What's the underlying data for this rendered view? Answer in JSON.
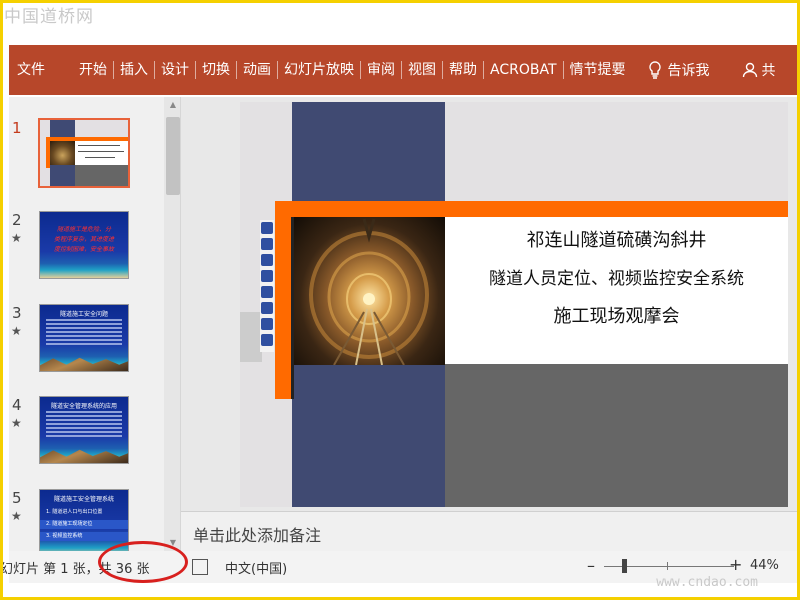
{
  "watermark": {
    "top": "中国道桥网",
    "bottom": "www.cndao.com"
  },
  "ribbon": {
    "tabs": [
      "文件",
      "开始",
      "插入",
      "设计",
      "切换",
      "动画",
      "幻灯片放映",
      "审阅",
      "视图",
      "帮助",
      "ACROBAT",
      "情节提要"
    ],
    "tell_me": "告诉我",
    "share": "共"
  },
  "thumbnails": [
    {
      "num": "1",
      "star": "",
      "active": true
    },
    {
      "num": "2",
      "star": "★",
      "text": [
        "隧道施工是危险、分",
        "类程序复杂，其进度进",
        "度控制困难，安全事故"
      ]
    },
    {
      "num": "3",
      "star": "★",
      "title": "隧道施工安全问题"
    },
    {
      "num": "4",
      "star": "★",
      "title": "隧道安全管理系统的应用"
    },
    {
      "num": "5",
      "star": "★",
      "title": "隧道施工安全管理系统",
      "items": [
        "1. 隧道进人口与出口位置",
        "2. 隧道施工现场定位",
        "3. 视频监控系统"
      ]
    }
  ],
  "slide": {
    "line1": "祁连山隧道硫磺沟斜井",
    "line2": "隧道人员定位、视频监控安全系统",
    "line3": "施工现场观摩会"
  },
  "notes": {
    "placeholder": "单击此处添加备注"
  },
  "status": {
    "slide_info": "幻灯片 第 1 张，共 36 张",
    "language": "中文(中国)",
    "zoom_minus": "–",
    "zoom_plus": "+",
    "zoom": "44%",
    "zoom_level": 0.44
  }
}
